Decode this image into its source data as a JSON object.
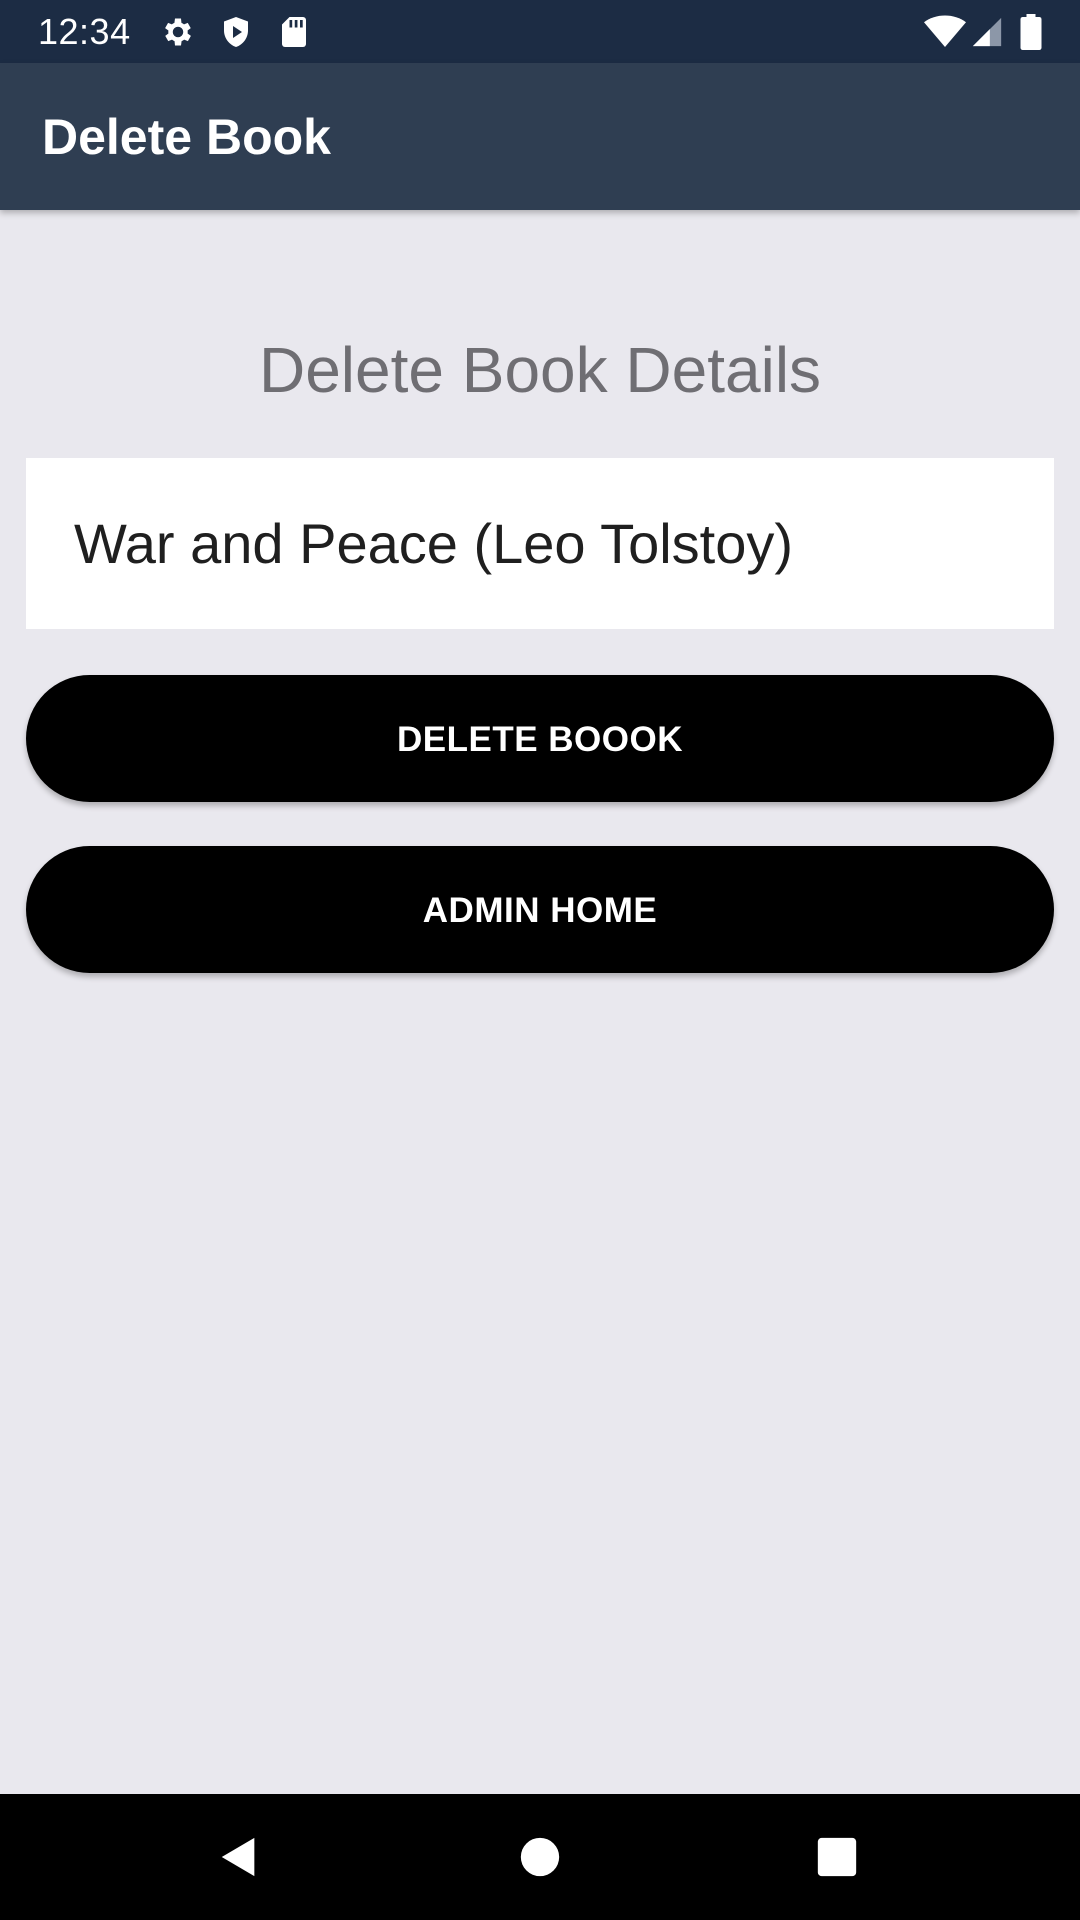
{
  "status_bar": {
    "time": "12:34",
    "left_icons": [
      "gear-icon",
      "shield-icon",
      "sd-card-icon"
    ],
    "right_icons": [
      "wifi-icon",
      "signal-icon",
      "battery-icon"
    ]
  },
  "app_bar": {
    "title": "Delete Book"
  },
  "main": {
    "heading": "Delete Book Details",
    "book_selector_value": "War and Peace (Leo Tolstoy)",
    "delete_button_label": "DELETE BOOOK",
    "home_button_label": "ADMIN HOME"
  },
  "nav_bar": {
    "icons": [
      "back-icon",
      "home-icon",
      "recents-icon"
    ]
  },
  "colors": {
    "status_bar": "#1C2C44",
    "app_bar": "#2F3E52",
    "background": "#E9E8EE",
    "button": "#000000"
  }
}
